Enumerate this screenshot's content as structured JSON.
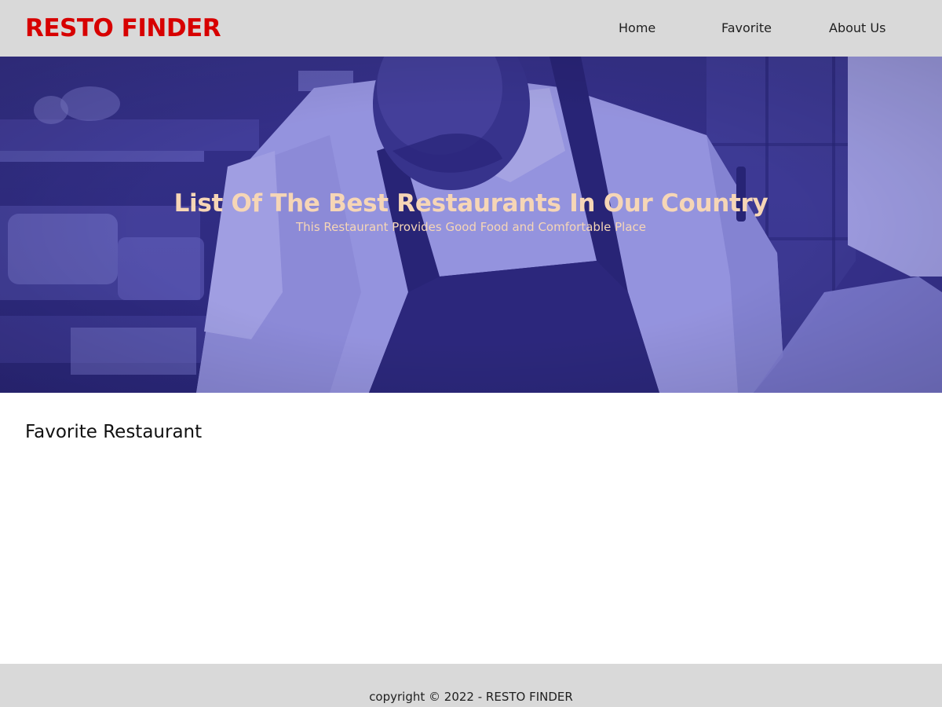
{
  "header": {
    "brand": "RESTO FINDER",
    "nav": {
      "home": "Home",
      "favorite": "Favorite",
      "about": "About Us"
    }
  },
  "hero": {
    "title": "List Of The Best Restaurants In Our Country",
    "subtitle": "This Restaurant Provides Good Food and Comfortable Place",
    "image_description": "duotone-photo-chef-in-kitchen"
  },
  "main": {
    "section_title": "Favorite Restaurant",
    "restaurants": []
  },
  "footer": {
    "copyright": "copyright © 2022 - RESTO FINDER"
  },
  "colors": {
    "brand": "#d70000",
    "header_bg": "#d9d9d9",
    "footer_bg": "#d9d9d9",
    "hero_dark": "#2b2679",
    "hero_light": "#a3a2ee",
    "hero_text": "#f6d6b6"
  }
}
